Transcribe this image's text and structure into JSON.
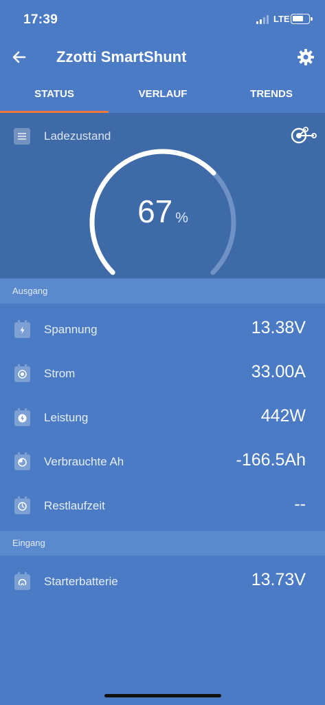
{
  "status_bar": {
    "time": "17:39",
    "network": "LTE"
  },
  "header": {
    "title": "Zzotti SmartShunt"
  },
  "tabs": [
    {
      "label": "STATUS",
      "active": true
    },
    {
      "label": "VERLAUF",
      "active": false
    },
    {
      "label": "TRENDS",
      "active": false
    }
  ],
  "gauge": {
    "label": "Ladezustand",
    "value": "67",
    "unit": "%",
    "fraction": 0.67
  },
  "sections": {
    "ausgang": {
      "title": "Ausgang",
      "rows": [
        {
          "label": "Spannung",
          "value": "13.38V",
          "icon": "bolt-icon"
        },
        {
          "label": "Strom",
          "value": "33.00A",
          "icon": "current-icon"
        },
        {
          "label": "Leistung",
          "value": "442W",
          "icon": "power-icon"
        },
        {
          "label": "Verbrauchte Ah",
          "value": "-166.5Ah",
          "icon": "consumed-icon"
        },
        {
          "label": "Restlaufzeit",
          "value": "--",
          "icon": "clock-icon"
        }
      ]
    },
    "eingang": {
      "title": "Eingang",
      "rows": [
        {
          "label": "Starterbatterie",
          "value": "13.73V",
          "icon": "starter-icon"
        }
      ]
    }
  },
  "colors": {
    "background": "#4a7bc4",
    "panel": "#3f6aa8",
    "section_header": "#5b89cd",
    "tab_indicator": "#f37a3b"
  }
}
